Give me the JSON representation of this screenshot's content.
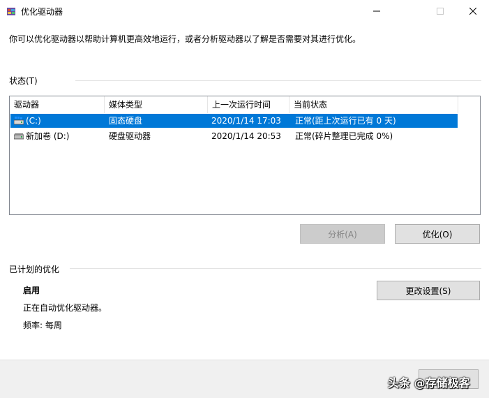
{
  "window": {
    "title": "优化驱动器",
    "controls": [
      "minimize-icon",
      "maximize-icon",
      "close-icon"
    ]
  },
  "intro_text": "你可以优化驱动器以帮助计算机更高效地运行，或者分析驱动器以了解是否需要对其进行优化。",
  "status_section": {
    "label": "状态(T)",
    "columns": [
      "驱动器",
      "媒体类型",
      "上一次运行时间",
      "当前状态"
    ],
    "rows": [
      {
        "icon": "ssd-drive-icon",
        "drive": "(C:)",
        "media": "固态硬盘",
        "last_run": "2020/1/14 17:03",
        "status": "正常(距上次运行已有 0 天)",
        "selected": true
      },
      {
        "icon": "hdd-drive-icon",
        "drive": "新加卷 (D:)",
        "media": "硬盘驱动器",
        "last_run": "2020/1/14 20:53",
        "status": "正常(碎片整理已完成 0%)",
        "selected": false
      }
    ]
  },
  "buttons": {
    "analyze": "分析(A)",
    "optimize": "优化(O)",
    "change_settings": "更改设置(S)"
  },
  "schedule_section": {
    "label": "已计划的优化",
    "status": "启用",
    "description": "正在自动优化驱动器。",
    "frequency": "频率: 每周"
  },
  "watermark": "头条 @存储极客",
  "colors": {
    "selection": "#0078d7",
    "footer": "#f0f0f0",
    "button": "#e1e1e1"
  }
}
